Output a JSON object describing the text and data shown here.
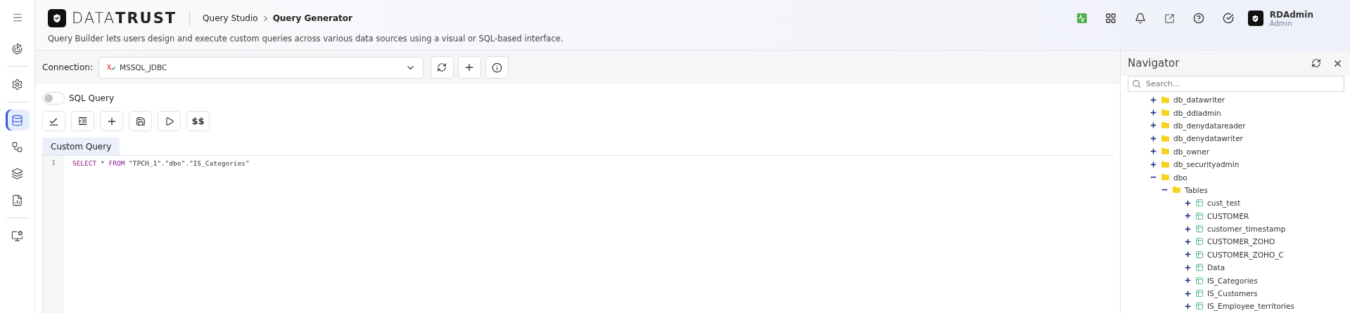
{
  "sidebar": {
    "menu_button": {
      "selected": false
    },
    "groups": [
      [
        {
          "selected": false
        }
      ],
      [
        {
          "selected": false
        }
      ],
      [
        {
          "selected": true
        },
        {
          "selected": false
        },
        {
          "selected": false
        },
        {
          "selected": false
        }
      ],
      [
        {
          "selected": false
        }
      ]
    ]
  },
  "header": {
    "logo": "DATA**TRUST**",
    "breadcrumb": [
      {
        "label": "Query Studio",
        "current": false
      },
      {
        "label": "Query Generator",
        "current": true
      }
    ],
    "description": "Query Builder lets users design and execute custom queries across various data sources using a visual or SQL-based interface.",
    "user": {
      "name": "RDAdmin",
      "role": "Admin"
    }
  },
  "connection": {
    "label": "Connection:",
    "value": "MSSQL_JDBC"
  },
  "sql_toggle": {
    "label": "SQL Query",
    "on": false
  },
  "toolbar": [
    {
      "kind": "validate"
    },
    {
      "kind": "indent"
    },
    {
      "kind": "add"
    },
    {
      "kind": "save"
    },
    {
      "kind": "run"
    },
    {
      "kind": "text",
      "label": "$$"
    }
  ],
  "tabs": [
    {
      "label": "Custom Query",
      "selected": true
    }
  ],
  "editor": {
    "lines": [
      {
        "number": "1",
        "tokens": [
          {
            "kind": "keyword",
            "text": "SELECT"
          },
          {
            "kind": "plain",
            "text": " * "
          },
          {
            "kind": "keyword",
            "text": "FROM"
          },
          {
            "kind": "plain",
            "text": " \"TPCH_1\".\"dbo\".\"IS_Categories\""
          }
        ]
      }
    ]
  },
  "navigator": {
    "title": "Navigator",
    "search": {
      "placeholder": "Search..."
    },
    "tree": [
      {
        "label": "db_datawriter",
        "kind": "folder",
        "expanded": false
      },
      {
        "label": "db_ddladmin",
        "kind": "folder",
        "expanded": false
      },
      {
        "label": "db_denydatareader",
        "kind": "folder",
        "expanded": false
      },
      {
        "label": "db_denydatawriter",
        "kind": "folder",
        "expanded": false
      },
      {
        "label": "db_owner",
        "kind": "folder",
        "expanded": false
      },
      {
        "label": "db_securityadmin",
        "kind": "folder",
        "expanded": false
      },
      {
        "label": "dbo",
        "kind": "folder",
        "expanded": true,
        "children": [
          {
            "label": "Tables",
            "kind": "folder",
            "expanded": true,
            "children": [
              {
                "label": "cust_test",
                "kind": "table",
                "expanded": false
              },
              {
                "label": "CUSTOMER",
                "kind": "table",
                "expanded": false
              },
              {
                "label": "customer_timestamp",
                "kind": "table",
                "expanded": false
              },
              {
                "label": "CUSTOMER_ZOHO",
                "kind": "table",
                "expanded": false
              },
              {
                "label": "CUSTOMER_ZOHO_C",
                "kind": "table",
                "expanded": false
              },
              {
                "label": "Data",
                "kind": "table",
                "expanded": false
              },
              {
                "label": "IS_Categories",
                "kind": "table",
                "expanded": false
              },
              {
                "label": "IS_Customers",
                "kind": "table",
                "expanded": false
              },
              {
                "label": "IS_Employee_territories",
                "kind": "table",
                "expanded": false
              }
            ]
          }
        ]
      }
    ]
  }
}
